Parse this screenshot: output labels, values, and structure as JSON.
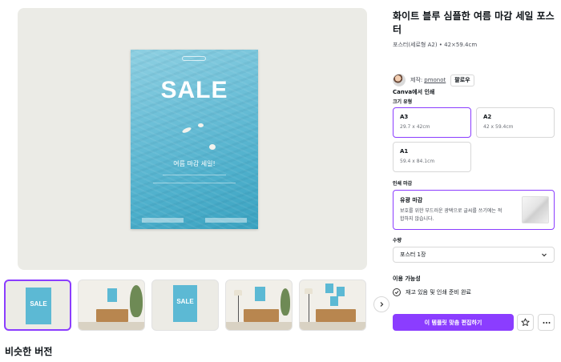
{
  "product": {
    "title": "화이트 블루 심플한 여름 마감 세일 포스터",
    "meta": "포스터(세로형 A2) • 42×59.4cm"
  },
  "creator": {
    "label": "제작:",
    "name": "pmonot",
    "follow_label": "팔로우"
  },
  "poster": {
    "headline": "SALE",
    "subtitle": "여름 마감 세일!"
  },
  "print": {
    "section_title": "Canva에서 인쇄",
    "size_label": "크기 유형",
    "sizes": [
      {
        "name": "A3",
        "dims": "29.7 x 42cm"
      },
      {
        "name": "A2",
        "dims": "42 x 59.4cm"
      },
      {
        "name": "A1",
        "dims": "59.4 x 84.1cm"
      }
    ],
    "selected_size": "A3",
    "finish_label": "인쇄 마감",
    "finish": {
      "name": "유광 마감",
      "description": "보호를 위한 부드러운 광택으로 글씨를 쓰기에는 적합하지 않습니다."
    }
  },
  "quantity": {
    "label": "수량",
    "value": "포스터 1장"
  },
  "availability": {
    "label": "이용 가능성",
    "status": "재고 있음 및 인쇄 준비 완료"
  },
  "actions": {
    "primary_label": "이 템플릿 맞춤 편집하기"
  },
  "thumbnails": [
    {
      "caption": "SALE"
    },
    {
      "caption": ""
    },
    {
      "caption": "SALE"
    },
    {
      "caption": ""
    },
    {
      "caption": ""
    }
  ],
  "similar": {
    "title": "비슷한 버전"
  },
  "colors": {
    "accent": "#8b3dff",
    "poster_blue": "#5cb9d4"
  },
  "icons": {
    "next": "chevron-right-icon",
    "favorite": "star-icon",
    "more": "more-icon",
    "dropdown": "chevron-down-icon",
    "check": "check-circle-icon"
  }
}
